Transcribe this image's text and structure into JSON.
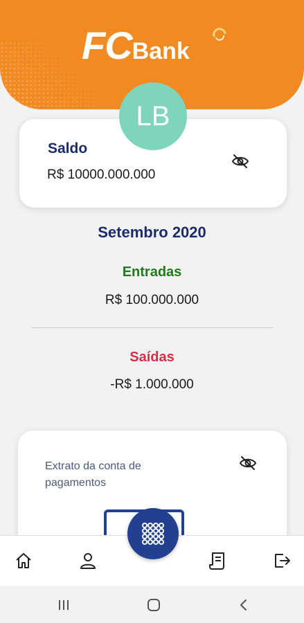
{
  "header": {
    "logo_fc": "FC",
    "logo_bank": "Bank",
    "brand_color": "#f28a22"
  },
  "user": {
    "initials": "LB",
    "avatar_color": "#7fd4bc"
  },
  "balance": {
    "title": "Saldo",
    "value": "R$ 10000.000.000"
  },
  "summary": {
    "month": "Setembro 2020",
    "income_label": "Entradas",
    "income_value": "R$ 100.000.000",
    "expense_label": "Saídas",
    "expense_value": "-R$ 1.000.000"
  },
  "statement": {
    "title": "Extrato da conta de pagamentos"
  },
  "nav": {
    "items": [
      "home-icon",
      "profile-icon",
      "keypad-icon",
      "receipt-icon",
      "logout-icon"
    ],
    "accent": "#233f8f"
  },
  "colors": {
    "primary_text": "#1b2b6b",
    "income": "#1f7a1a",
    "expense": "#d92b4a"
  }
}
